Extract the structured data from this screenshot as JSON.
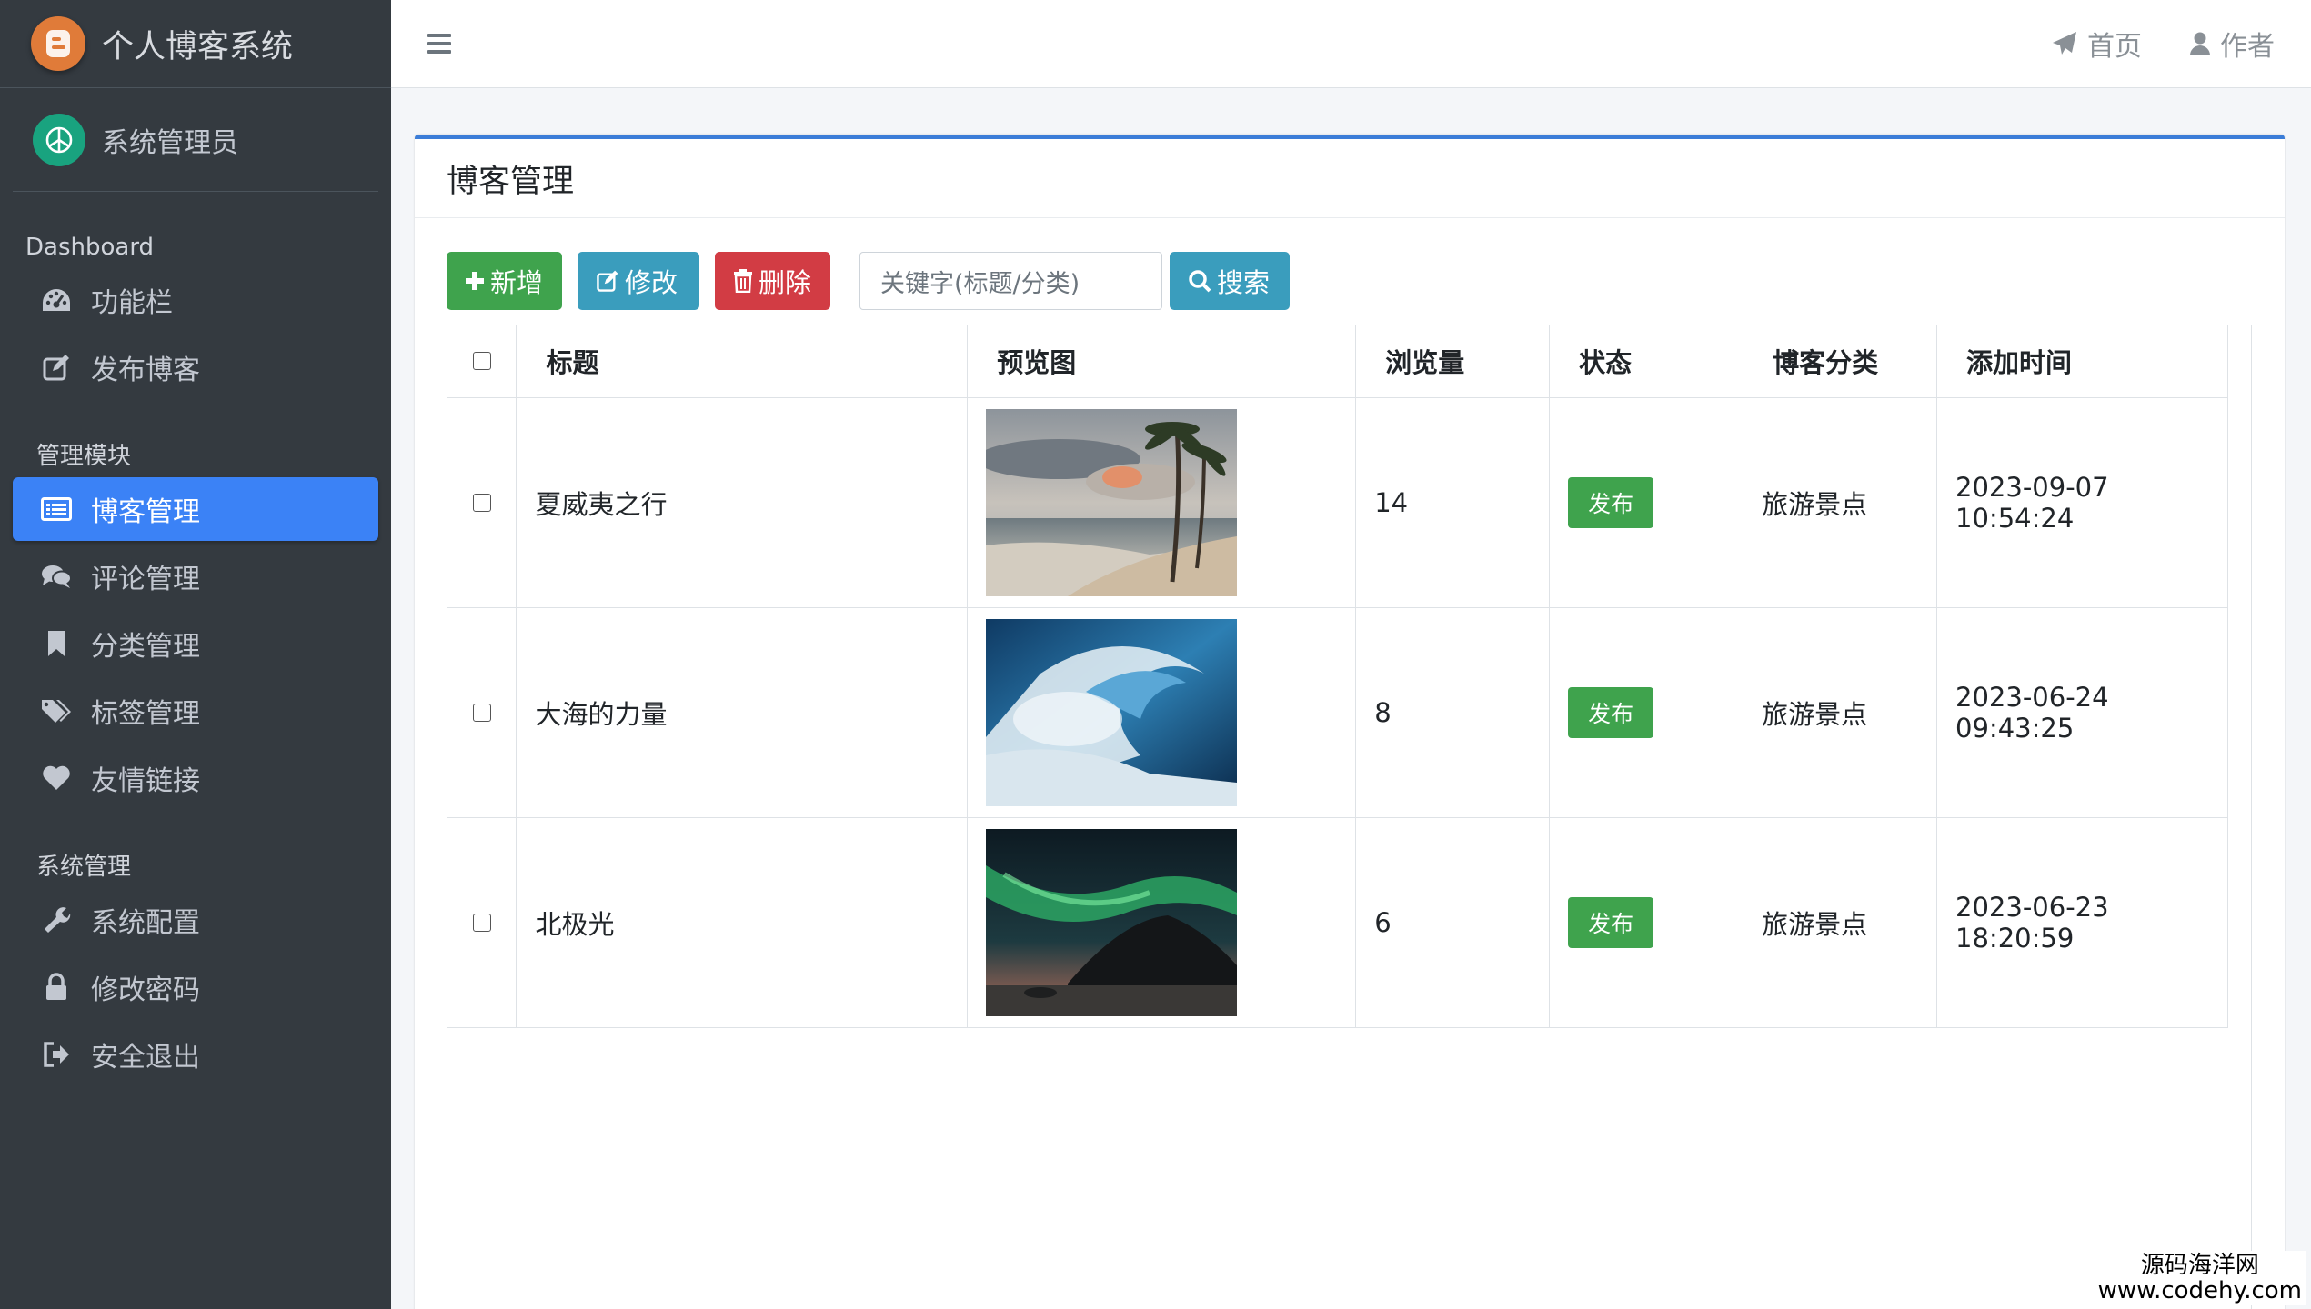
{
  "sidebar": {
    "brand": "个人博客系统",
    "user": "系统管理员",
    "section_dashboard": "Dashboard",
    "dashboard_items": [
      {
        "label": "功能栏",
        "icon": "dashboard-icon"
      },
      {
        "label": "发布博客",
        "icon": "edit-icon"
      }
    ],
    "section_manage": "管理模块",
    "manage_items": [
      {
        "label": "博客管理",
        "icon": "list-icon",
        "active": true
      },
      {
        "label": "评论管理",
        "icon": "comments-icon"
      },
      {
        "label": "分类管理",
        "icon": "bookmark-icon"
      },
      {
        "label": "标签管理",
        "icon": "tags-icon"
      },
      {
        "label": "友情链接",
        "icon": "heart-icon"
      }
    ],
    "section_system": "系统管理",
    "system_items": [
      {
        "label": "系统配置",
        "icon": "wrench-icon"
      },
      {
        "label": "修改密码",
        "icon": "lock-icon"
      },
      {
        "label": "安全退出",
        "icon": "sign-out-icon"
      }
    ]
  },
  "topbar": {
    "home": "首页",
    "author": "作者"
  },
  "card": {
    "title": "博客管理",
    "buttons": {
      "add": "新增",
      "edit": "修改",
      "delete": "删除",
      "search": "搜索"
    },
    "search_placeholder": "关键字(标题/分类)"
  },
  "table": {
    "headers": [
      "标题",
      "预览图",
      "浏览量",
      "状态",
      "博客分类",
      "添加时间"
    ],
    "rows": [
      {
        "title": "夏威夷之行",
        "image": "beach-palm-image",
        "views": "14",
        "status": "发布",
        "category": "旅游景点",
        "time": "2023-09-07 10:54:24"
      },
      {
        "title": "大海的力量",
        "image": "ocean-wave-image",
        "views": "8",
        "status": "发布",
        "category": "旅游景点",
        "time": "2023-06-24 09:43:25"
      },
      {
        "title": "北极光",
        "image": "aurora-image",
        "views": "6",
        "status": "发布",
        "category": "旅游景点",
        "time": "2023-06-23 18:20:59"
      }
    ]
  },
  "watermark": {
    "line1": "源码海洋网",
    "line2": "www.codehy.com"
  },
  "colors": {
    "sidebar_bg": "#343a40",
    "active_nav": "#3b82f6",
    "card_border": "#3b7dd8",
    "success": "#3fa34d",
    "info": "#3a9dbd",
    "danger": "#d23c44"
  }
}
